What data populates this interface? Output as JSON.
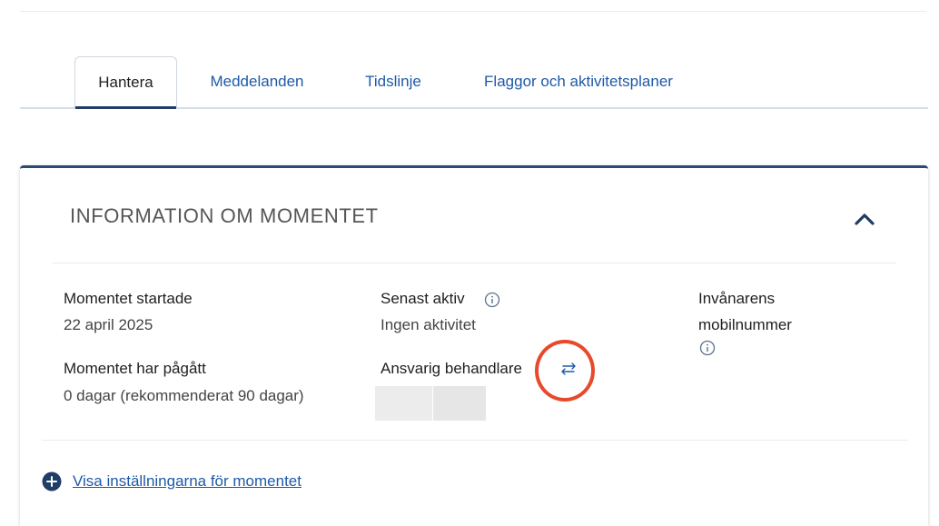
{
  "tabs": [
    {
      "label": "Hantera",
      "active": true
    },
    {
      "label": "Meddelanden",
      "active": false
    },
    {
      "label": "Tidslinje",
      "active": false
    },
    {
      "label": "Flaggor och aktivitetsplaner",
      "active": false
    }
  ],
  "panel": {
    "title": "INFORMATION OM MOMENTET",
    "collapse_icon": "chevron-up-icon",
    "fields": {
      "started": {
        "label": "Momentet startade",
        "value": "22 april 2025"
      },
      "duration": {
        "label": "Momentet har pågått",
        "value": "0 dagar (rekommenderat 90 dagar)"
      },
      "last_active": {
        "label": "Senast aktiv",
        "value": "Ingen aktivitet",
        "icon": "info-icon"
      },
      "handler": {
        "label": "Ansvarig behandlare",
        "icon": "swap-arrows-icon"
      },
      "phone": {
        "label_line1": "Invånarens",
        "label_line2": "mobilnummer",
        "icon": "info-icon"
      }
    },
    "settings_link": {
      "label": "Visa inställningarna för momentet",
      "icon": "plus-circle-icon"
    }
  },
  "colors": {
    "link": "#1f5aa8",
    "accent": "#2b4a73",
    "highlight": "#e8492a"
  }
}
